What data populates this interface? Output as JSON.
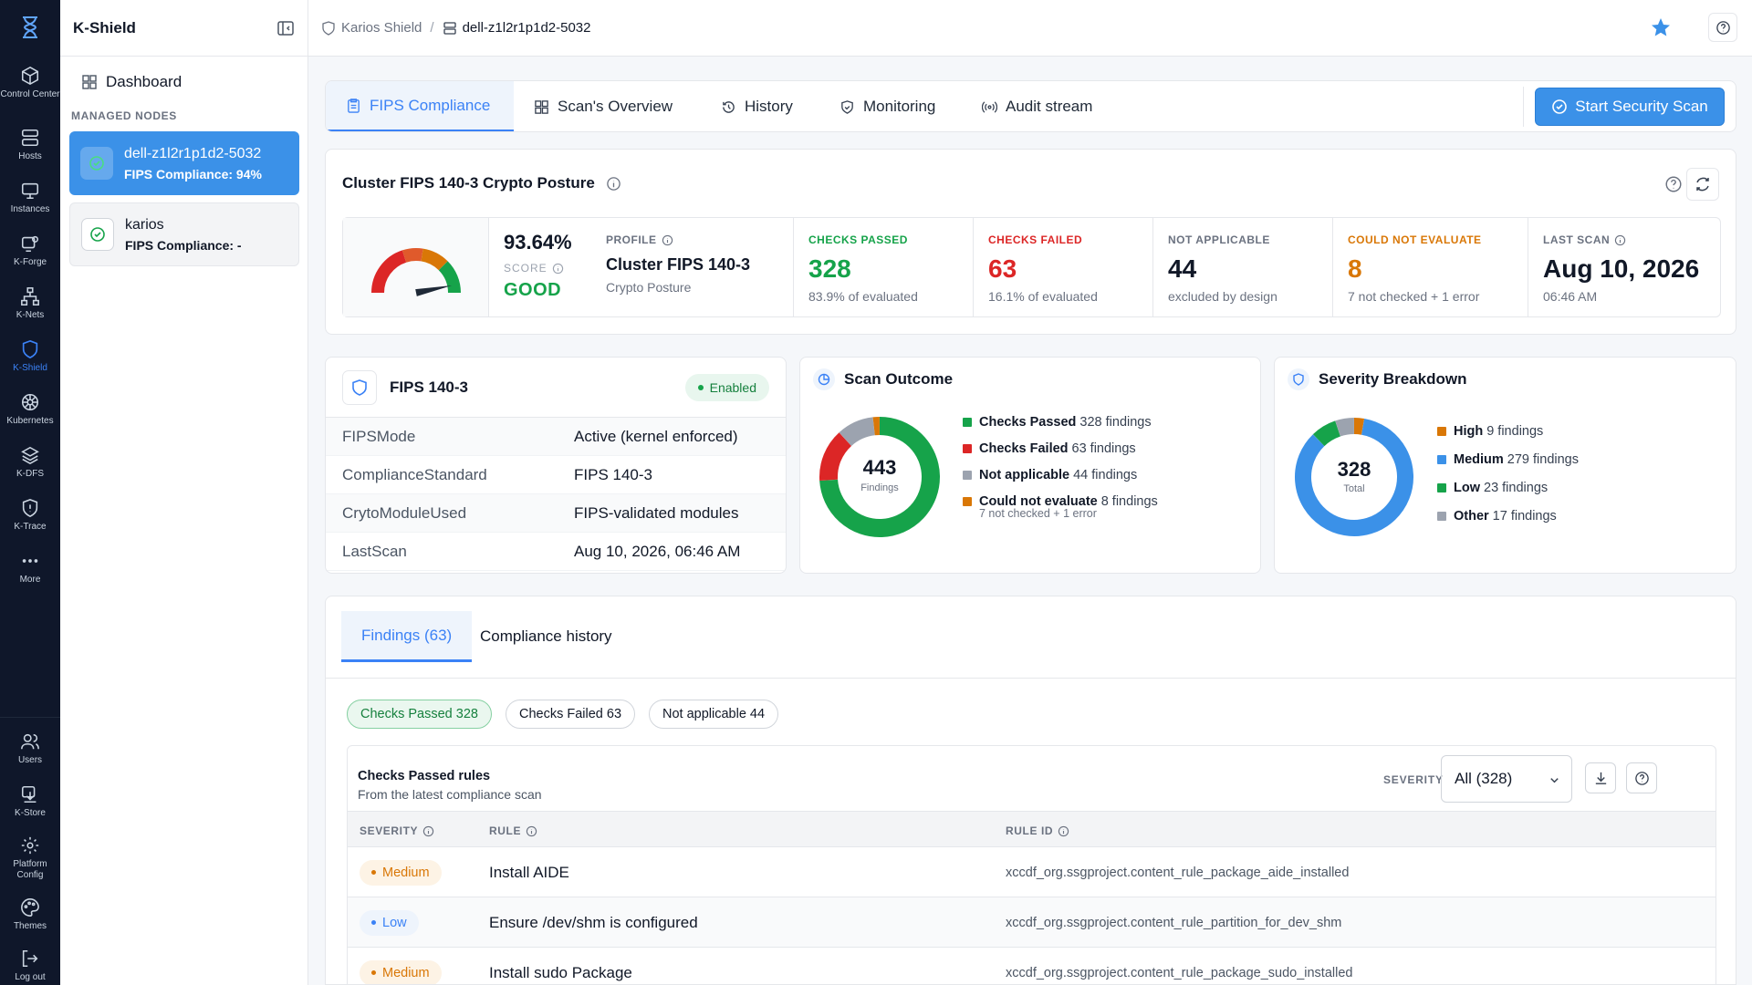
{
  "rail": {
    "items": [
      {
        "label": "Control Center",
        "icon": "cube-icon"
      },
      {
        "label": "Hosts",
        "icon": "server-icon"
      },
      {
        "label": "Instances",
        "icon": "monitor-icon"
      },
      {
        "label": "K-Forge",
        "icon": "forge-icon"
      },
      {
        "label": "K-Nets",
        "icon": "network-icon"
      },
      {
        "label": "K-Shield",
        "icon": "shield-icon"
      },
      {
        "label": "Kubernetes",
        "icon": "helm-icon"
      },
      {
        "label": "K-DFS",
        "icon": "layers-icon"
      },
      {
        "label": "K-Trace",
        "icon": "trace-icon"
      },
      {
        "label": "More",
        "icon": "dots-icon"
      }
    ],
    "bottom_items": [
      {
        "label": "Users",
        "icon": "users-icon"
      },
      {
        "label": "K-Store",
        "icon": "store-icon"
      },
      {
        "label": "Platform Config",
        "icon": "gear-icon"
      },
      {
        "label": "Themes",
        "icon": "palette-icon"
      },
      {
        "label": "Log out",
        "icon": "logout-icon"
      }
    ]
  },
  "sidebar": {
    "title": "K-Shield",
    "dashboard_label": "Dashboard",
    "section_label": "MANAGED NODES",
    "nodes": [
      {
        "name": "dell-z1l2r1p1d2-5032",
        "sub": "FIPS Compliance: 94%"
      },
      {
        "name": "karios",
        "sub": "FIPS Compliance: -"
      }
    ]
  },
  "breadcrumb": {
    "root": "Karios Shield",
    "separator": "/",
    "current": "dell-z1l2r1p1d2-5032"
  },
  "tabs": [
    {
      "label": "FIPS Compliance"
    },
    {
      "label": "Scan's Overview"
    },
    {
      "label": "History"
    },
    {
      "label": "Monitoring"
    },
    {
      "label": "Audit stream"
    }
  ],
  "scan_button_label": "Start Security Scan",
  "posture": {
    "title": "Cluster FIPS 140-3 Crypto Posture",
    "score": "93.64%",
    "score_label": "SCORE",
    "grade": "GOOD",
    "gauge_value": 0.9364,
    "profile": {
      "label": "PROFILE",
      "value": "Cluster FIPS 140-3",
      "sub": "Crypto Posture"
    },
    "passed": {
      "label": "CHECKS PASSED",
      "value": "328",
      "sub": "83.9% of evaluated"
    },
    "failed": {
      "label": "CHECKS FAILED",
      "value": "63",
      "sub": "16.1% of evaluated"
    },
    "na": {
      "label": "NOT APPLICABLE",
      "value": "44",
      "sub": "excluded by design"
    },
    "cne": {
      "label": "COULD NOT EVALUATE",
      "value": "8",
      "sub": "7 not checked + 1 error"
    },
    "last": {
      "label": "LAST SCAN",
      "value": "Aug 10, 2026",
      "sub": "06:46 AM"
    }
  },
  "fips": {
    "title": "FIPS 140-3",
    "badge": "Enabled",
    "rows": [
      {
        "k": "FIPSMode",
        "v": "Active (kernel enforced)"
      },
      {
        "k": "ComplianceStandard",
        "v": "FIPS 140-3"
      },
      {
        "k": "CrytoModuleUsed",
        "v": "FIPS-validated modules"
      },
      {
        "k": "LastScan",
        "v": "Aug 10, 2026, 06:46 AM"
      }
    ]
  },
  "outcome": {
    "title": "Scan Outcome",
    "center_value": "443",
    "center_label": "Findings",
    "segments": [
      {
        "name": "Checks Passed",
        "value": 328,
        "text": "328 findings",
        "color": "#16a34a"
      },
      {
        "name": "Checks Failed",
        "value": 63,
        "text": "63 findings",
        "color": "#dc2626"
      },
      {
        "name": "Not applicable",
        "value": 44,
        "text": "44 findings",
        "color": "#9ca3af"
      },
      {
        "name": "Could not evaluate",
        "value": 8,
        "text": "8 findings",
        "color": "#d97706"
      }
    ],
    "note": "7 not checked + 1 error"
  },
  "severity": {
    "title": "Severity Breakdown",
    "center_value": "328",
    "center_label": "Total",
    "segments": [
      {
        "name": "High",
        "value": 9,
        "text": "9 findings",
        "color": "#d97706"
      },
      {
        "name": "Medium",
        "value": 279,
        "text": "279 findings",
        "color": "#3b91e8"
      },
      {
        "name": "Low",
        "value": 23,
        "text": "23 findings",
        "color": "#16a34a"
      },
      {
        "name": "Other",
        "value": 17,
        "text": "17 findings",
        "color": "#9ca3af"
      }
    ]
  },
  "findings": {
    "tabs": [
      "Findings (63)",
      "Compliance history"
    ],
    "chips": [
      "Checks Passed 328",
      "Checks Failed 63",
      "Not applicable 44"
    ],
    "rules_title": "Checks Passed rules",
    "rules_sub": "From the latest compliance scan",
    "severity_label": "SEVERITY",
    "severity_value": "All (328)",
    "columns": [
      "SEVERITY",
      "RULE",
      "RULE ID"
    ],
    "rows": [
      {
        "severity": "Medium",
        "rule": "Install AIDE",
        "id": "xccdf_org.ssgproject.content_rule_package_aide_installed"
      },
      {
        "severity": "Low",
        "rule": "Ensure /dev/shm is configured",
        "id": "xccdf_org.ssgproject.content_rule_partition_for_dev_shm"
      },
      {
        "severity": "Medium",
        "rule": "Install sudo Package",
        "id": "xccdf_org.ssgproject.content_rule_package_sudo_installed"
      }
    ]
  },
  "colors": {
    "accent": "#3b91e8",
    "success": "#16a34a",
    "danger": "#dc2626",
    "warning": "#d97706",
    "rail_bg": "#0f172a"
  }
}
